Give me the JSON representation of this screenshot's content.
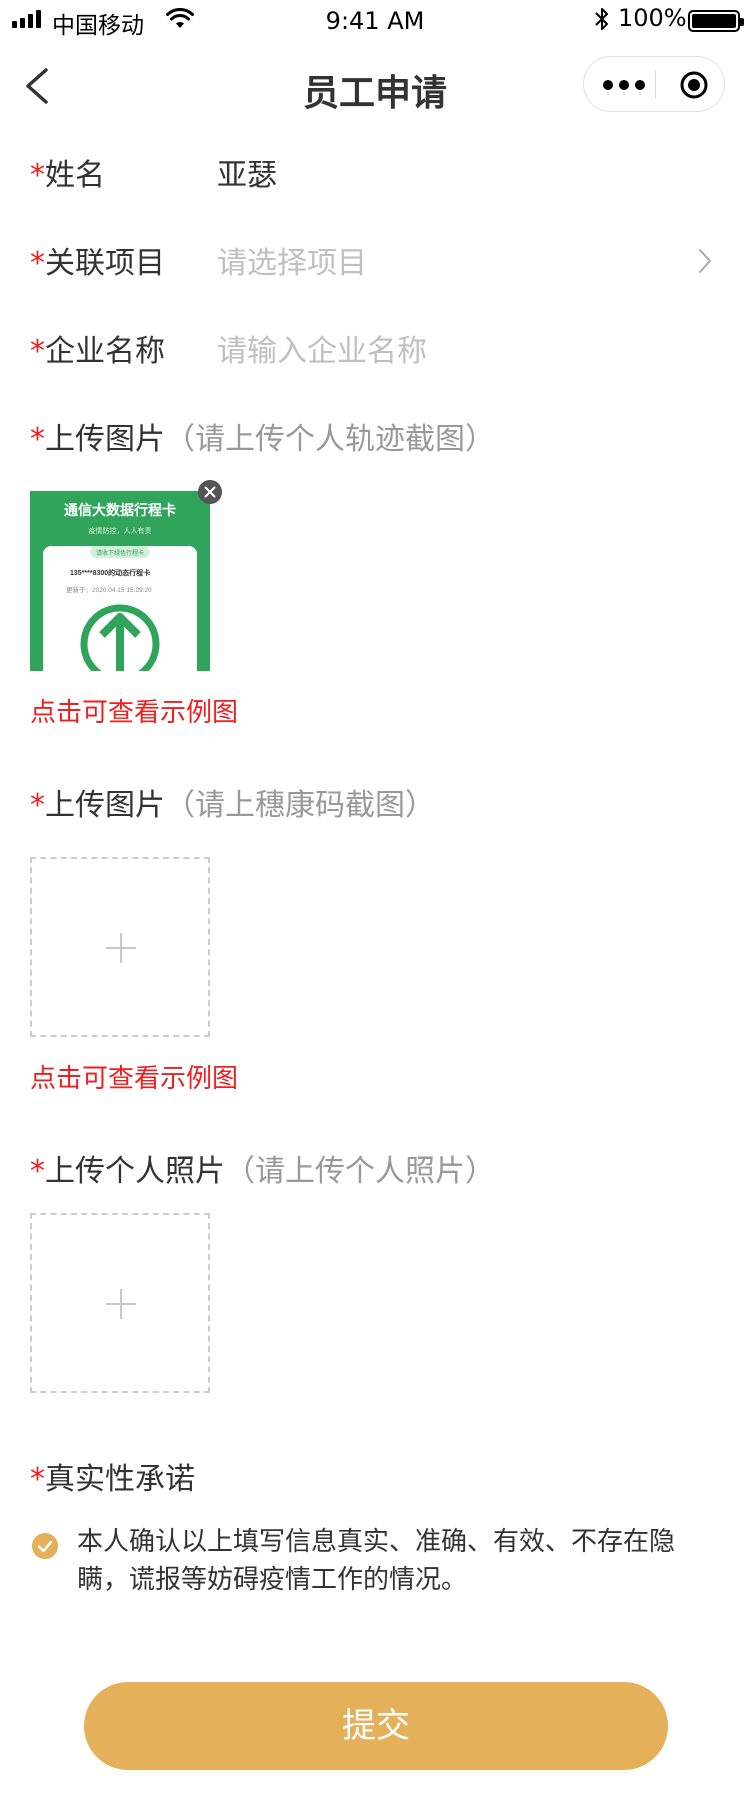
{
  "status_bar": {
    "carrier": "中国移动",
    "time": "9:41 AM",
    "battery": "100%"
  },
  "nav": {
    "title": "员工申请"
  },
  "form": {
    "name": {
      "star": "*",
      "label": "姓名",
      "value": "亚瑟"
    },
    "project": {
      "star": "*",
      "label": "关联项目",
      "placeholder": "请选择项目"
    },
    "company": {
      "star": "*",
      "label": "企业名称",
      "placeholder": "请输入企业名称"
    },
    "itinerary_upload": {
      "star": "*",
      "label": "上传图片",
      "hint": "（请上传个人轨迹截图）",
      "example_link": "点击可查看示例图"
    },
    "health_code_upload": {
      "star": "*",
      "label": "上传图片",
      "hint": "（请上穗康码截图）",
      "example_link": "点击可查看示例图"
    },
    "photo_upload": {
      "star": "*",
      "label": "上传个人照片",
      "hint": "（请上传个人照片）"
    },
    "commitment": {
      "star": "*",
      "label": "真实性承诺",
      "text": "本人确认以上填写信息真实、准确、有效、不存在隐瞒，谎报等妨碍疫情工作的情况。",
      "checked": true
    }
  },
  "thumbnail": {
    "title": "通信大数据行程卡",
    "subtitle": "疫情防控，人人有责",
    "pill": "请收下绿色行程卡",
    "phone_line": "135****8300的动态行程卡",
    "updated": "更新于：2020.04.15 15:29:20"
  },
  "submit_label": "提交",
  "colors": {
    "accent": "#e4b05a",
    "required": "#ee1f1f",
    "placeholder": "#c0c0c0",
    "card_green": "#2fa45a"
  }
}
